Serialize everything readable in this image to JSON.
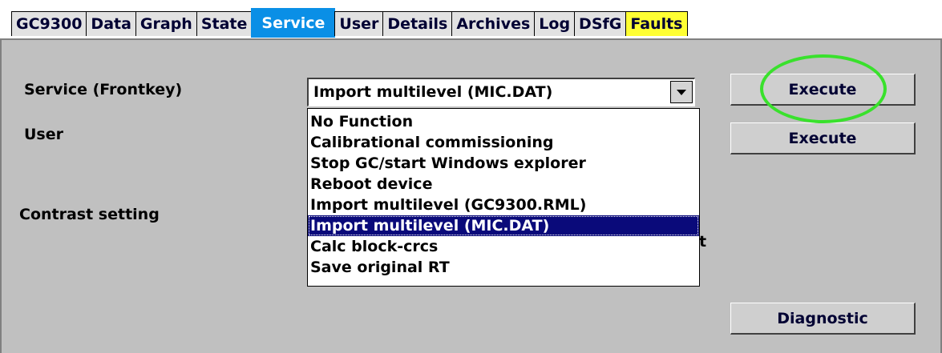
{
  "tabs": [
    {
      "label": "GC9300",
      "state": "normal"
    },
    {
      "label": "Data",
      "state": "normal"
    },
    {
      "label": "Graph",
      "state": "normal"
    },
    {
      "label": "State",
      "state": "normal"
    },
    {
      "label": "Service",
      "state": "active"
    },
    {
      "label": "User",
      "state": "normal"
    },
    {
      "label": "Details",
      "state": "normal"
    },
    {
      "label": "Archives",
      "state": "normal"
    },
    {
      "label": "Log",
      "state": "normal"
    },
    {
      "label": "DSfG",
      "state": "normal"
    },
    {
      "label": "Faults",
      "state": "warning"
    }
  ],
  "labels": {
    "service_frontkey": "Service (Frontkey)",
    "user": "User",
    "contrast": "Contrast setting",
    "occluded_fragment": "t"
  },
  "service_combo": {
    "value": "Import multilevel (MIC.DAT)",
    "arrow_icon": "chevron-down-icon"
  },
  "dropdown": {
    "options": [
      "No Function",
      "Calibrational commissioning",
      "Stop GC/start Windows explorer",
      "Reboot device",
      "Import multilevel (GC9300.RML)",
      "Import multilevel (MIC.DAT)",
      "Calc block-crcs",
      "Save original RT"
    ],
    "selected_index": 5
  },
  "buttons": {
    "execute_service": "Execute",
    "execute_user": "Execute",
    "diagnostic": "Diagnostic"
  },
  "colors": {
    "active_tab": "#0a8fe6",
    "warning_tab": "#ffff33",
    "selection": "#0a0a7a",
    "highlight_ring": "#39e12c"
  }
}
